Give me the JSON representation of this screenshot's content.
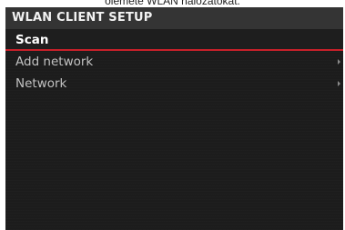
{
  "caption": "olemete WLAN hálózatokat.",
  "screen": {
    "title": "WLAN CLIENT SETUP",
    "accent_color": "#c8202a",
    "menu": [
      {
        "label": "Scan",
        "selected": true
      },
      {
        "label": "Add network",
        "selected": false,
        "submenu_icon": "chevron-right-icon"
      },
      {
        "label": "Network",
        "selected": false,
        "submenu_icon": "chevron-right-icon"
      }
    ]
  }
}
